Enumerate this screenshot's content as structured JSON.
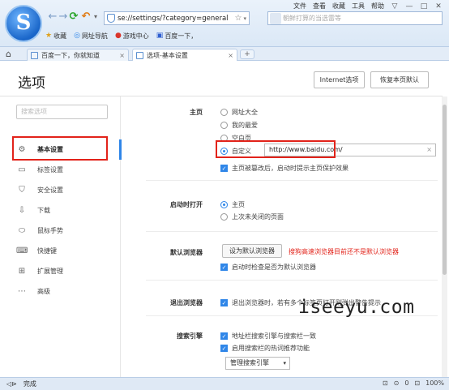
{
  "browser": {
    "logo_glyph": "S",
    "menu": [
      "文件",
      "查看",
      "收藏",
      "工具",
      "帮助"
    ],
    "window_buttons": [
      "▽",
      "—",
      "□",
      "✕"
    ],
    "back_glyph": "←",
    "forward_glyph": "→",
    "refresh_glyph": "⟳",
    "undo_glyph": "↶",
    "undo_dd_glyph": "▾",
    "address": "se://settings/?category=general",
    "star_glyph": "☆",
    "dd_glyph": "▾",
    "search_placeholder": "朝鲜打算的当选雷等",
    "favorites": [
      {
        "icon": "★",
        "label": "收藏",
        "color": "#e0a11b"
      },
      {
        "icon": "◎",
        "label": "网址导航",
        "color": "#2f86e8"
      },
      {
        "icon": "●",
        "label": "游戏中心",
        "color": "#d9352b"
      },
      {
        "icon": "▣",
        "label": "百度一下，",
        "color": "#2f5fd0"
      }
    ],
    "home_glyph": "⌂",
    "tabs": [
      {
        "label": "百度一下，你就知道",
        "close": "×"
      },
      {
        "label": "选项-基本设置",
        "close": "×"
      }
    ],
    "new_tab": "+"
  },
  "page": {
    "title": "选项",
    "internet_options": "Internet选项",
    "restore_defaults": "恢复本页默认",
    "side_search_placeholder": "搜索选项",
    "sidebar": [
      {
        "icon": "⚙",
        "label": "基本设置",
        "active": true
      },
      {
        "icon": "▭",
        "label": "标签设置",
        "active": false
      },
      {
        "icon": "⛉",
        "label": "安全设置",
        "active": false
      },
      {
        "icon": "⇩",
        "label": "下载",
        "active": false
      },
      {
        "icon": "⬭",
        "label": "鼠标手势",
        "active": false
      },
      {
        "icon": "⌨",
        "label": "快捷键",
        "active": false
      },
      {
        "icon": "⊞",
        "label": "扩展管理",
        "active": false
      },
      {
        "icon": "⋯",
        "label": "高级",
        "active": false
      }
    ],
    "homepage": {
      "label": "主页",
      "options": [
        "网址大全",
        "我的最爱",
        "空白页",
        "自定义"
      ],
      "selected": 3,
      "custom_url": "http://www.baidu.com/",
      "clear_glyph": "×",
      "protect_check": "主页被篡改后，启动时提示主页保护效果"
    },
    "startup": {
      "label": "启动时打开",
      "options": [
        "主页",
        "上次未关闭的页面"
      ],
      "selected": 0
    },
    "default_browser": {
      "label": "默认浏览器",
      "button": "设为默认浏览器",
      "warning": "搜狗高速浏览器目前还不是默认浏览器",
      "check": "启动时检查是否为默认浏览器"
    },
    "exit_browser": {
      "label": "退出浏览器",
      "check": "退出浏览器时，若有多个标签页打开则弹出警告提示"
    },
    "search_engine": {
      "label": "搜索引擎",
      "checks": [
        "地址栏搜索引擎与搜索栏一致",
        "启用搜索栏的热词推荐功能"
      ],
      "select": "管理搜索引擎",
      "select_arrow": "▾"
    }
  },
  "watermark": "iseeyu.com",
  "status": {
    "text": "完成",
    "right_items": [
      "◁⊳",
      "⊡",
      "⊙",
      "0",
      "⊡",
      "100%"
    ]
  }
}
